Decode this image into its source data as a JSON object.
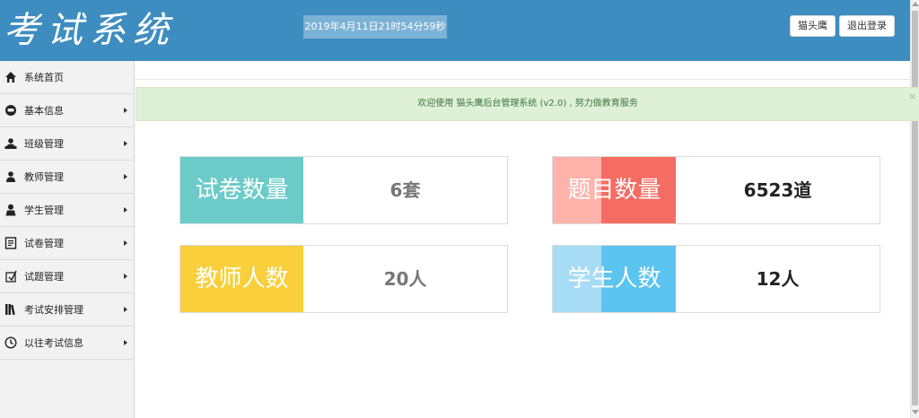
{
  "header": {
    "logo_text": "考试系统",
    "datetime": "2019年4月11日21时54分59秒",
    "user_button": "猫头鹰",
    "logout_button": "退出登录"
  },
  "sidebar": {
    "items": [
      {
        "label": "系统首页",
        "icon": "home-icon"
      },
      {
        "label": "基本信息",
        "icon": "info-icon"
      },
      {
        "label": "班级管理",
        "icon": "class-icon"
      },
      {
        "label": "教师管理",
        "icon": "teacher-icon"
      },
      {
        "label": "学生管理",
        "icon": "student-icon"
      },
      {
        "label": "试卷管理",
        "icon": "paper-icon"
      },
      {
        "label": "试题管理",
        "icon": "question-icon"
      },
      {
        "label": "考试安排管理",
        "icon": "books-icon"
      },
      {
        "label": "以往考试信息",
        "icon": "clock-icon"
      }
    ]
  },
  "alert": {
    "text_prefix": "欢迎使用 猫头鹰后台管理系统 (v2.0) , 努力做",
    "text_emphasis": "教育服务",
    "close": "×"
  },
  "stats": [
    {
      "label": "试卷数量",
      "value": "6套"
    },
    {
      "label": "题目数量",
      "value": "6523道"
    },
    {
      "label": "教师人数",
      "value": "20人"
    },
    {
      "label": "学生人数",
      "value": "12人"
    }
  ],
  "colors": {
    "header": "#3d8dc0",
    "teal": "#6ccbc9",
    "red": "#f56c63",
    "yellow": "#f9cf3c",
    "blue": "#5bc4ef"
  }
}
